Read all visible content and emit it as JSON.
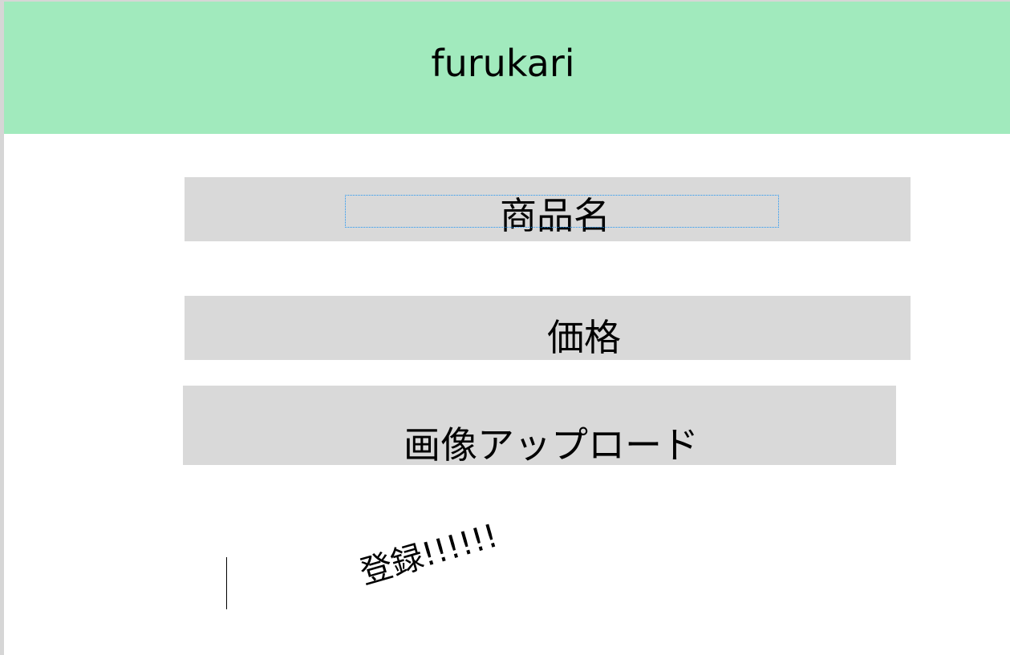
{
  "header": {
    "title": "furukari",
    "color": "#a1eabd"
  },
  "form": {
    "product_name_label": "商品名",
    "price_label": "価格",
    "image_upload_label": "画像アップロード",
    "register_label": "登録!!!!!!"
  }
}
